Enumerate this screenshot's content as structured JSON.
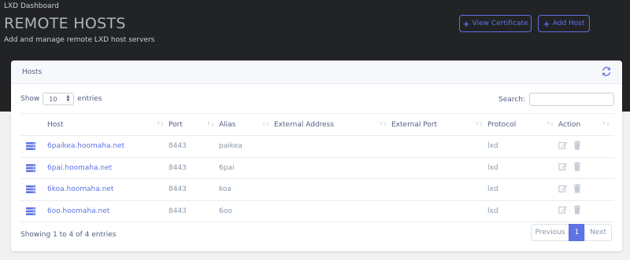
{
  "header": {
    "breadcrumb": "LXD Dashboard",
    "title": "REMOTE HOSTS",
    "subtitle": "Add and manage remote LXD host servers",
    "buttons": {
      "view_certificate": "View Certificate",
      "add_host": "Add Host"
    }
  },
  "card": {
    "title": "Hosts"
  },
  "table_controls": {
    "show_label": "Show",
    "entries_value": "10",
    "entries_label": "entries",
    "search_label": "Search:",
    "search_value": ""
  },
  "table": {
    "columns": [
      "Host",
      "Port",
      "Alias",
      "External Address",
      "External Port",
      "Protocol",
      "Action"
    ],
    "rows": [
      {
        "host": "6paikea.hoomaha.net",
        "port": "8443",
        "alias": "paikea",
        "external_address": "",
        "external_port": "",
        "protocol": "lxd"
      },
      {
        "host": "6pai.hoomaha.net",
        "port": "8443",
        "alias": "6pai",
        "external_address": "",
        "external_port": "",
        "protocol": "lxd"
      },
      {
        "host": "6koa.hoomaha.net",
        "port": "8443",
        "alias": "koa",
        "external_address": "",
        "external_port": "",
        "protocol": "lxd"
      },
      {
        "host": "6oo.hoomaha.net",
        "port": "8443",
        "alias": "6oo",
        "external_address": "",
        "external_port": "",
        "protocol": "lxd"
      }
    ]
  },
  "footer": {
    "info": "Showing 1 to 4 of 4 entries",
    "pagination": {
      "previous": "Previous",
      "current_page": "1",
      "next": "Next"
    }
  },
  "icons": {
    "server": "server-icon",
    "edit": "edit-icon",
    "delete": "trash-icon",
    "refresh": "refresh-icon",
    "add": "plus-icon"
  },
  "colors": {
    "accent": "#5e72e4",
    "header_bg": "#222325",
    "page_bg": "#f0f1f3"
  }
}
